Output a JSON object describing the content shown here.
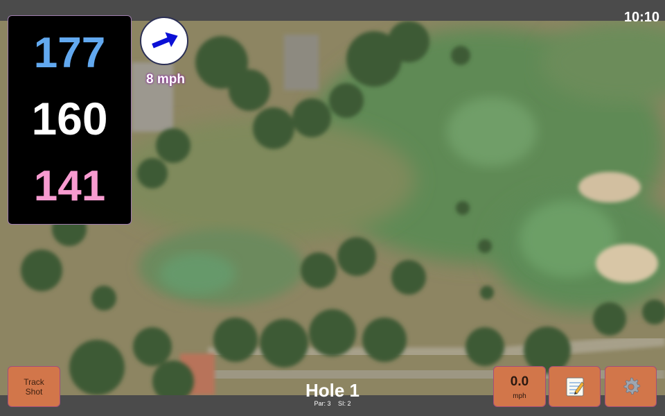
{
  "status": {
    "time": "10:10"
  },
  "yardage": {
    "back": "177",
    "middle": "160",
    "front": "141"
  },
  "wind": {
    "speed_text": "8 mph",
    "icon": "arrow-icon"
  },
  "hole": {
    "title": "Hole 1",
    "par": "Par: 3",
    "si": "SI: 2"
  },
  "controls": {
    "track_label": "Track Shot",
    "speed_value": "0.0",
    "speed_unit": "mph",
    "notes_icon": "notepad-icon",
    "settings_icon": "gear-icon"
  },
  "colors": {
    "back": "#62a9f0",
    "middle": "#ffffff",
    "front": "#f79bd0",
    "button": "#d2764a",
    "bar": "#4b4b4b"
  }
}
